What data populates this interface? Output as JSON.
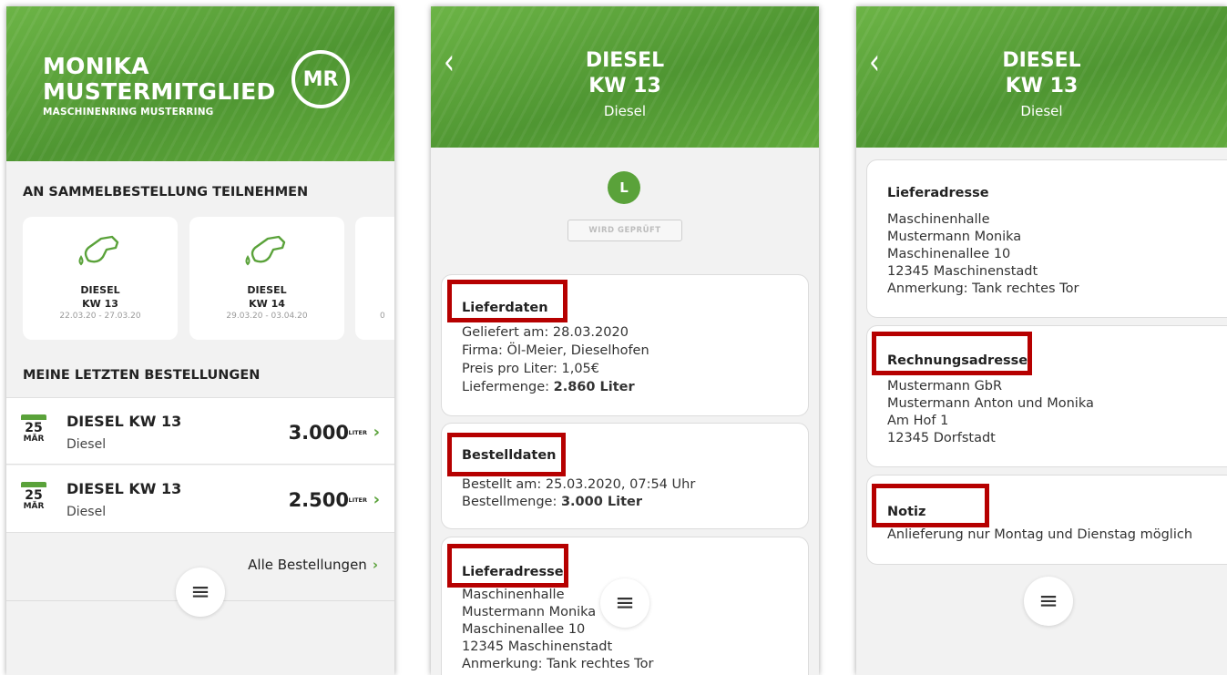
{
  "colors": {
    "accent": "#5aa23a",
    "highlight": "#b60000"
  },
  "screen1": {
    "member_name_line1": "MONIKA",
    "member_name_line2": "MUSTERMITGLIED",
    "member_org": "MASCHINENRING MUSTERRING",
    "logo_text": "MR",
    "section_join": "AN SAMMELBESTELLUNG TEILNEHMEN",
    "tiles": [
      {
        "icon": "fuel-nozzle-icon",
        "title": "DIESEL",
        "week": "KW 13",
        "range": "22.03.20 - 27.03.20"
      },
      {
        "icon": "fuel-nozzle-icon",
        "title": "DIESEL",
        "week": "KW 14",
        "range": "29.03.20 - 03.04.20"
      },
      {
        "icon": "fuel-nozzle-icon",
        "title": "",
        "week": "",
        "range": "0"
      }
    ],
    "section_orders": "MEINE LETZTEN BESTELLUNGEN",
    "orders": [
      {
        "day": "25",
        "month": "MÄR",
        "title": "DIESEL KW 13",
        "type": "Diesel",
        "amount": "3.000",
        "unit": "LITER"
      },
      {
        "day": "25",
        "month": "MÄR",
        "title": "DIESEL KW 13",
        "type": "Diesel",
        "amount": "2.500",
        "unit": "LITER"
      }
    ],
    "all_orders_label": "Alle Bestellungen",
    "chevron": "›",
    "menu_icon": "≡"
  },
  "screen2": {
    "back": "‹",
    "title_line1": "DIESEL",
    "title_line2": "KW 13",
    "subtitle": "Diesel",
    "status_letter": "L",
    "status_label": "WIRD GEPRÜFT",
    "lieferdaten": {
      "title": "Lieferdaten",
      "geliefert": "Geliefert am: 28.03.2020",
      "firma": "Firma: Öl-Meier, Dieselhofen",
      "preis": "Preis pro Liter: 1,05€",
      "menge_label": "Liefermenge: ",
      "menge_value": "2.860 Liter"
    },
    "bestelldaten": {
      "title": "Bestelldaten",
      "bestellt": "Bestellt am: 25.03.2020, 07:54 Uhr",
      "menge_label": "Bestellmenge: ",
      "menge_value": "3.000 Liter"
    },
    "lieferadresse": {
      "title": "Lieferadresse",
      "lines": [
        "Maschinenhalle",
        "Mustermann Monika",
        "Maschinenallee 10",
        "12345 Maschinenstadt",
        "Anmerkung: Tank rechtes Tor"
      ]
    },
    "menu_icon": "≡"
  },
  "screen3": {
    "back": "‹",
    "title_line1": "DIESEL",
    "title_line2": "KW 13",
    "subtitle": "Diesel",
    "lieferadresse": {
      "title": "Lieferadresse",
      "lines": [
        "Maschinenhalle",
        "Mustermann Monika",
        "Maschinenallee 10",
        "12345 Maschinenstadt",
        "Anmerkung: Tank rechtes Tor"
      ]
    },
    "rechnungsadresse": {
      "title": "Rechnungsadresse",
      "lines": [
        "Mustermann GbR",
        "Mustermann Anton und Monika",
        "Am Hof 1",
        "12345 Dorfstadt"
      ]
    },
    "notiz": {
      "title": "Notiz",
      "text": "Anlieferung nur Montag und Dienstag möglich"
    },
    "menu_icon": "≡"
  }
}
